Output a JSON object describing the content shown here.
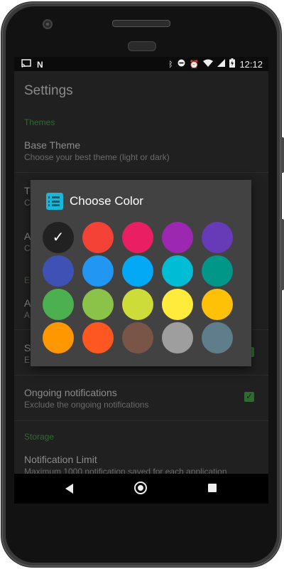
{
  "statusbar": {
    "time": "12:12",
    "left_icons": [
      "cast-icon",
      "app-n-icon"
    ],
    "right_icons": [
      "bluetooth-icon",
      "dnd-icon",
      "alarm-icon",
      "wifi-icon",
      "signal-icon",
      "battery-charging-icon"
    ]
  },
  "app": {
    "title": "Settings",
    "sections": {
      "themes": "Themes",
      "exclusion": "E",
      "storage": "Storage"
    },
    "prefs": {
      "base_theme": {
        "title": "Base Theme",
        "subtitle": "Choose your best theme (light or dark)"
      },
      "theme_color": {
        "title": "T",
        "subtitle": "C"
      },
      "accent": {
        "title": "A",
        "subtitle": "C"
      },
      "apps": {
        "title": "A",
        "subtitle": "A"
      },
      "system": {
        "title": "S",
        "subtitle": "E"
      },
      "ongoing": {
        "title": "Ongoing notifications",
        "subtitle": "Exclude the ongoing notifications",
        "checked": true
      },
      "limit": {
        "title": "Notification Limit",
        "subtitle": "Maximum 1000 notification saved for each application"
      }
    }
  },
  "dialog": {
    "title": "Choose Color",
    "icon": "list-icon",
    "selected_index": 0,
    "colors": [
      "#212121",
      "#f44336",
      "#e91e63",
      "#9c27b0",
      "#673ab7",
      "#3f51b5",
      "#2196f3",
      "#03a9f4",
      "#00bcd4",
      "#009688",
      "#4caf50",
      "#8bc34a",
      "#cddc39",
      "#ffeb3b",
      "#ffc107",
      "#ff9800",
      "#ff5722",
      "#795548",
      "#9e9e9e",
      "#607d8b"
    ]
  },
  "navbar": {
    "buttons": [
      "back",
      "home",
      "recents"
    ]
  }
}
